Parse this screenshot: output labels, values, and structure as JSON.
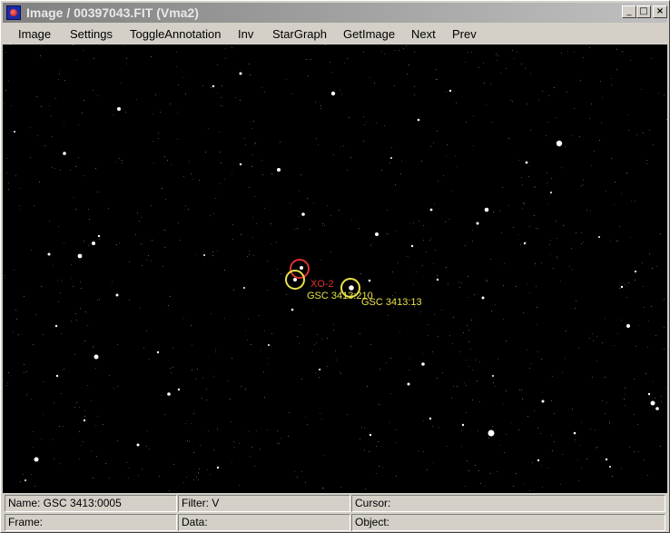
{
  "window": {
    "title": "Image / 00397043.FIT (Vma2)",
    "controls": {
      "minimize": "_",
      "maximize": "□",
      "close": "×"
    }
  },
  "menu": {
    "items": [
      "Image",
      "Settings",
      "ToggleAnnotation",
      "Inv",
      "StarGraph",
      "GetImage",
      "Next",
      "Prev"
    ]
  },
  "image": {
    "annotations": [
      {
        "label": "XO-2",
        "color": "#e03030"
      },
      {
        "label": "GSC 3413:210",
        "color": "#e8e04a"
      },
      {
        "label": "GSC 3413:13",
        "color": "#e8e04a"
      }
    ]
  },
  "status": {
    "name": "Name: GSC 3413:0005",
    "filter": "Filter: V",
    "cursor": "Cursor:",
    "frame": "Frame:",
    "data": "Data:",
    "object": "Object:"
  },
  "colors": {
    "chrome": "#d4d0c8",
    "titlebar_start": "#808080",
    "titlebar_end": "#c0c0c0",
    "sky": "#000000",
    "target_ring": "#e03030",
    "comparison_ring": "#e8e04a"
  }
}
